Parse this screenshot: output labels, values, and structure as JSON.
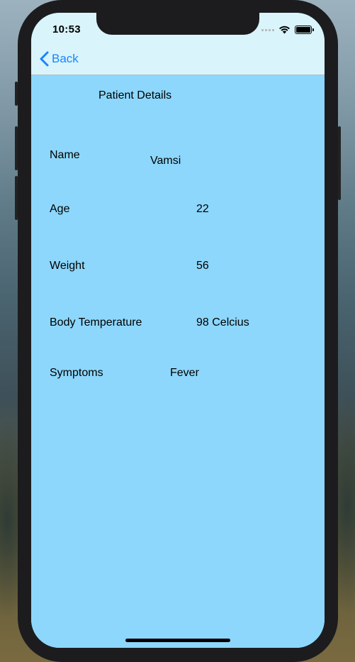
{
  "status_bar": {
    "time": "10:53"
  },
  "nav": {
    "back_label": "Back"
  },
  "page": {
    "title": "Patient Details"
  },
  "fields": {
    "name": {
      "label": "Name",
      "value": "Vamsi"
    },
    "age": {
      "label": "Age",
      "value": "22"
    },
    "weight": {
      "label": "Weight",
      "value": "56"
    },
    "temperature": {
      "label": "Body Temperature",
      "value": "98 Celcius"
    },
    "symptoms": {
      "label": "Symptoms",
      "value": "Fever"
    }
  },
  "colors": {
    "content_background": "#8dd7fc",
    "nav_background": "#d9f4fb",
    "accent": "#1a84ff"
  }
}
